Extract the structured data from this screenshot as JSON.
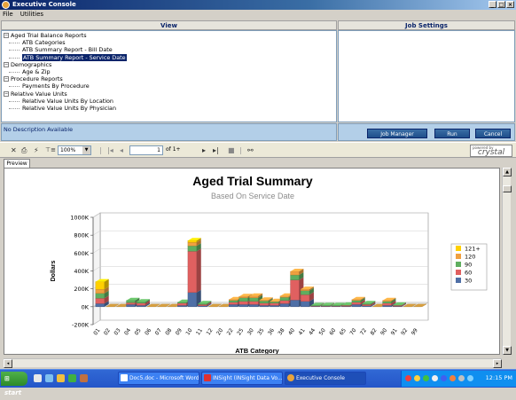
{
  "window": {
    "title": "Executive Console"
  },
  "menu": [
    "File",
    "Utilities"
  ],
  "view_header": "View",
  "job_settings_header": "Job Settings",
  "tree": [
    {
      "label": "Aged Trial Balance Reports",
      "expander": "⊟",
      "children": [
        {
          "label": "ATB Categories",
          "selected": false
        },
        {
          "label": "ATB Summary Report - Bill Date",
          "selected": false
        },
        {
          "label": "ATB Summary Report - Service Date",
          "selected": true
        }
      ]
    },
    {
      "label": "Demographics",
      "expander": "⊟",
      "children": [
        {
          "label": "Age & Zip",
          "selected": false
        }
      ]
    },
    {
      "label": "Procedure Reports",
      "expander": "⊟",
      "children": [
        {
          "label": "Payments By Procedure",
          "selected": false
        }
      ]
    },
    {
      "label": "Relative Value Units",
      "expander": "⊟",
      "children": [
        {
          "label": "Relative Value Units By Location",
          "selected": false
        },
        {
          "label": "Relative Value Units By Physician",
          "selected": false
        }
      ]
    }
  ],
  "description": "No Description Available",
  "buttons": {
    "job_manager": "Job Manager",
    "run": "Run",
    "cancel": "Cancel"
  },
  "toolbar": {
    "zoom": "100%",
    "page": "1",
    "page_of": "of 1+",
    "powered_by": "powered by",
    "brand": "crystal"
  },
  "tab": "Preview",
  "chart_data": {
    "type": "bar",
    "stacked": true,
    "title": "Aged Trial Summary",
    "subtitle": "Based On Service Date",
    "xlabel": "ATB Category",
    "ylabel": "Dollars",
    "ylim": [
      -200000,
      1000000
    ],
    "yticks": [
      "1000K",
      "800K",
      "600K",
      "400K",
      "200K",
      "0K",
      "-200K"
    ],
    "legend_position": "right",
    "categories": [
      "01",
      "02",
      "03",
      "04",
      "05",
      "06",
      "07",
      "08",
      "09",
      "10",
      "11",
      "12",
      "20",
      "22",
      "25",
      "30",
      "35",
      "36",
      "38",
      "40",
      "41",
      "44",
      "50",
      "60",
      "65",
      "70",
      "72",
      "82",
      "90",
      "91",
      "92",
      "99"
    ],
    "series": [
      {
        "name": "30",
        "color": "#4f6fa6",
        "values": [
          35000,
          0,
          0,
          25000,
          15000,
          0,
          0,
          0,
          15000,
          160000,
          10000,
          0,
          0,
          25000,
          25000,
          25000,
          15000,
          15000,
          35000,
          75000,
          60000,
          5000,
          5000,
          5000,
          5000,
          25000,
          10000,
          0,
          15000,
          5000,
          0,
          0
        ]
      },
      {
        "name": "60",
        "color": "#e06060",
        "values": [
          60000,
          0,
          0,
          20000,
          25000,
          0,
          0,
          0,
          25000,
          460000,
          15000,
          0,
          0,
          25000,
          35000,
          35000,
          25000,
          25000,
          35000,
          225000,
          75000,
          5000,
          5000,
          5000,
          10000,
          25000,
          15000,
          0,
          25000,
          10000,
          0,
          0
        ]
      },
      {
        "name": "90",
        "color": "#5fae5f",
        "values": [
          55000,
          0,
          0,
          25000,
          15000,
          0,
          0,
          0,
          10000,
          60000,
          10000,
          0,
          0,
          20000,
          40000,
          40000,
          25000,
          15000,
          35000,
          55000,
          45000,
          5000,
          5000,
          5000,
          5000,
          20000,
          10000,
          0,
          20000,
          5000,
          0,
          0
        ]
      },
      {
        "name": "120",
        "color": "#f0a040",
        "values": [
          45000,
          0,
          0,
          0,
          0,
          0,
          0,
          0,
          0,
          40000,
          0,
          0,
          0,
          10000,
          15000,
          20000,
          10000,
          5000,
          15000,
          40000,
          15000,
          0,
          0,
          0,
          0,
          10000,
          0,
          0,
          10000,
          0,
          0,
          0
        ]
      },
      {
        "name": "121+",
        "color": "#ffd000",
        "values": [
          85000,
          0,
          0,
          0,
          0,
          0,
          0,
          0,
          0,
          20000,
          0,
          0,
          0,
          0,
          0,
          0,
          0,
          0,
          0,
          0,
          0,
          0,
          0,
          0,
          0,
          0,
          0,
          0,
          0,
          0,
          0,
          0
        ]
      }
    ]
  },
  "taskbar": {
    "start": "start",
    "tasks": [
      "Doc5.doc - Microsoft Word",
      "INSight (INSight Data Vo...",
      "Executive Console"
    ],
    "clock": "12:15 PM"
  }
}
